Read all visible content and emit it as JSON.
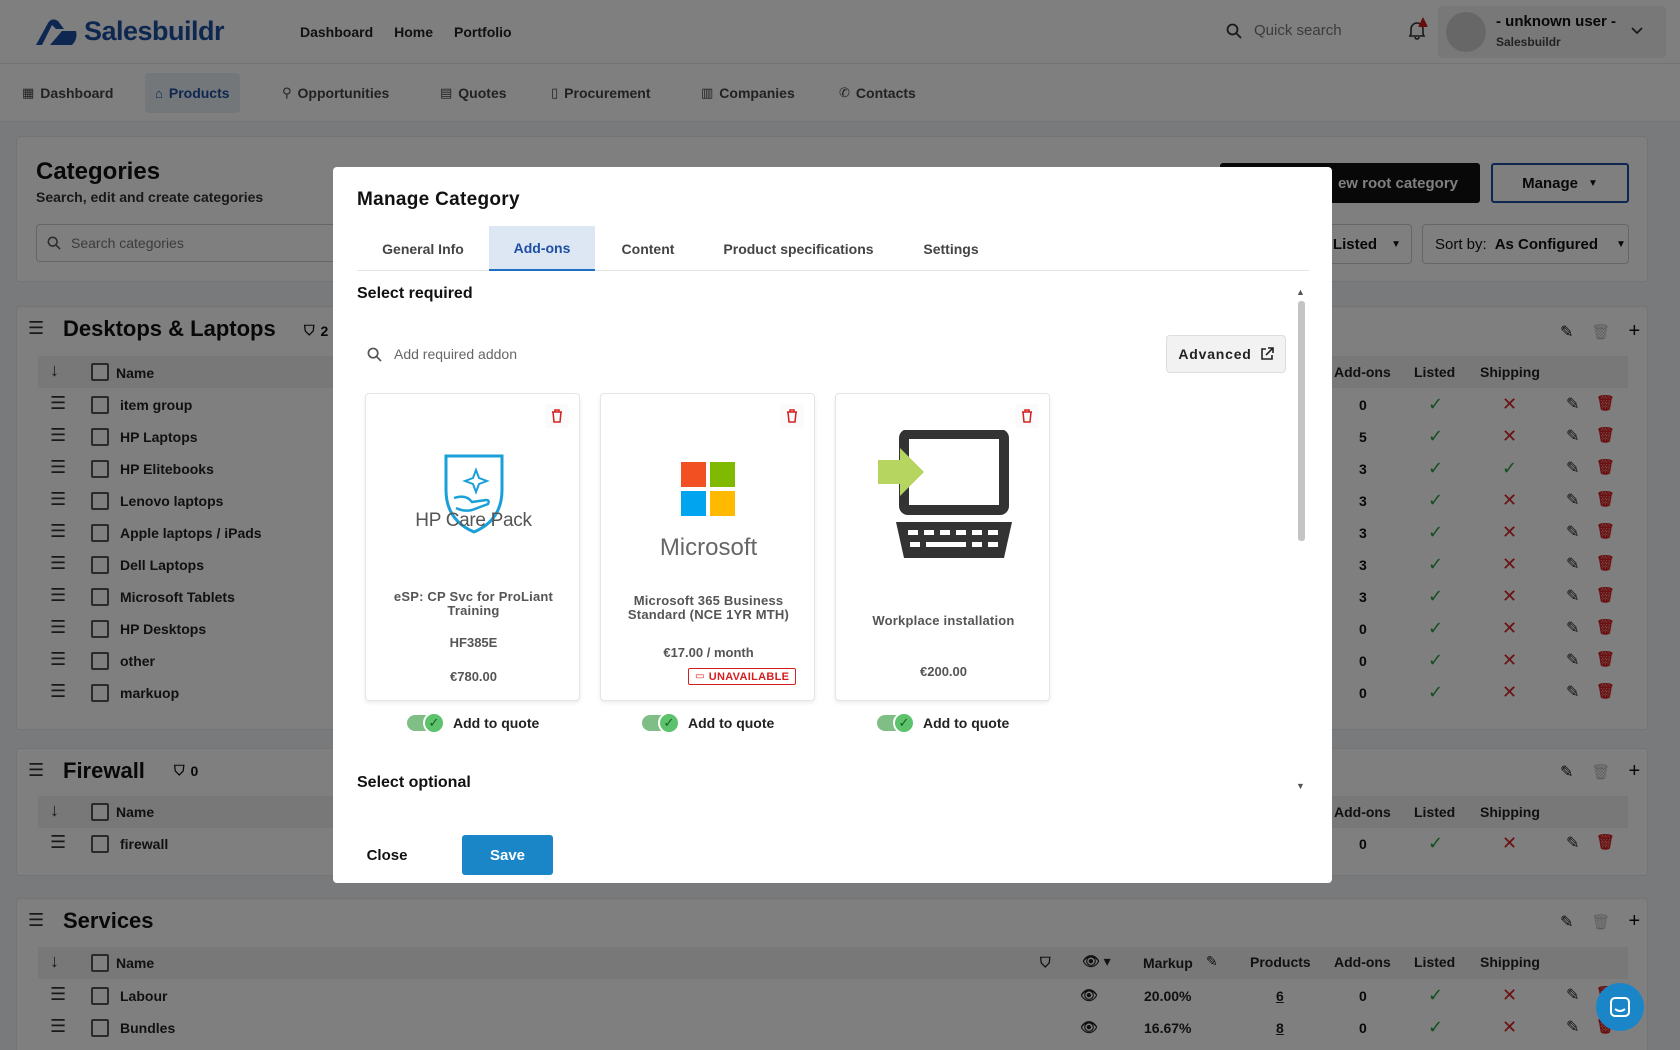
{
  "header": {
    "logo_text": "Salesbuildr",
    "nav": [
      "Dashboard",
      "Home",
      "Portfolio"
    ],
    "search_placeholder": "Quick search",
    "user_name": "- unknown user -",
    "user_org": "Salesbuildr"
  },
  "subnav": {
    "items": [
      "Dashboard",
      "Products",
      "Opportunities",
      "Quotes",
      "Procurement",
      "Companies",
      "Contacts"
    ],
    "active": "Products"
  },
  "categories": {
    "title": "Categories",
    "subtitle": "Search, edit and create categories",
    "search_placeholder": "Search categories",
    "new_root_label": "New root category",
    "new_root_visible": "ew root category",
    "manage_label": "Manage",
    "listed_filter": "Listed",
    "sort_label": "Sort by:",
    "sort_value": "As Configured"
  },
  "groups": [
    {
      "title": "Desktops & Laptops",
      "filter_count": "2",
      "columns": [
        "Name",
        "Add-ons",
        "Listed",
        "Shipping"
      ],
      "rows": [
        {
          "name": "item group",
          "addons": "0",
          "listed": true,
          "shipping": false
        },
        {
          "name": "HP Laptops",
          "addons": "5",
          "listed": true,
          "shipping": false
        },
        {
          "name": "HP Elitebooks",
          "addons": "3",
          "listed": true,
          "shipping": true
        },
        {
          "name": "Lenovo laptops",
          "addons": "3",
          "listed": true,
          "shipping": false
        },
        {
          "name": "Apple laptops / iPads",
          "addons": "3",
          "listed": true,
          "shipping": false
        },
        {
          "name": "Dell Laptops",
          "addons": "3",
          "listed": true,
          "shipping": false
        },
        {
          "name": "Microsoft Tablets",
          "addons": "3",
          "listed": true,
          "shipping": false
        },
        {
          "name": "HP Desktops",
          "addons": "0",
          "listed": true,
          "shipping": false
        },
        {
          "name": "other",
          "addons": "0",
          "listed": true,
          "shipping": false
        },
        {
          "name": "markuop",
          "addons": "0",
          "listed": true,
          "shipping": false
        }
      ]
    },
    {
      "title": "Firewall",
      "filter_count": "0",
      "columns": [
        "Name",
        "Add-ons",
        "Listed",
        "Shipping"
      ],
      "rows": [
        {
          "name": "firewall",
          "addons": "0",
          "listed": true,
          "shipping": false
        }
      ]
    },
    {
      "title": "Services",
      "columns": [
        "Name",
        "Markup",
        "Products",
        "Add-ons",
        "Listed",
        "Shipping"
      ],
      "rows": [
        {
          "name": "Labour",
          "markup": "20.00%",
          "products": "6",
          "addons": "0",
          "listed": true,
          "shipping": false
        },
        {
          "name": "Bundles",
          "markup": "16.67%",
          "products": "8",
          "addons": "0",
          "listed": true,
          "shipping": false
        }
      ]
    }
  ],
  "modal": {
    "title": "Manage Category",
    "tabs": [
      "General Info",
      "Add-ons",
      "Content",
      "Product specifications",
      "Settings"
    ],
    "active_tab": "Add-ons",
    "section_required": "Select required",
    "section_optional": "Select optional",
    "addon_search_placeholder": "Add required addon",
    "advanced_label": "Advanced",
    "cards": [
      {
        "name": "eSP: CP Svc for ProLiant Training",
        "sku": "HF385E",
        "price": "€780.00",
        "image": "hp-care-pack-logo",
        "logo_text": "HP Care Pack",
        "unavailable": false,
        "add_to_quote": true
      },
      {
        "name": "Microsoft 365 Business Standard (NCE 1YR MTH)",
        "sku": "",
        "price": "€17.00 / month",
        "image": "microsoft-logo",
        "logo_text": "Microsoft",
        "unavailable": true,
        "add_to_quote": true
      },
      {
        "name": "Workplace installation",
        "sku": "",
        "price": "€200.00",
        "image": "workplace-computer-icon",
        "unavailable": false,
        "add_to_quote": true
      }
    ],
    "unavailable_label": "UNAVAILABLE",
    "add_to_quote_label": "Add to quote",
    "close_label": "Close",
    "save_label": "Save"
  },
  "colors": {
    "brand_blue": "#1d4fa3",
    "save_blue": "#1a86c8",
    "listed_green": "#2a9d3a",
    "cross_red": "#d42020"
  }
}
